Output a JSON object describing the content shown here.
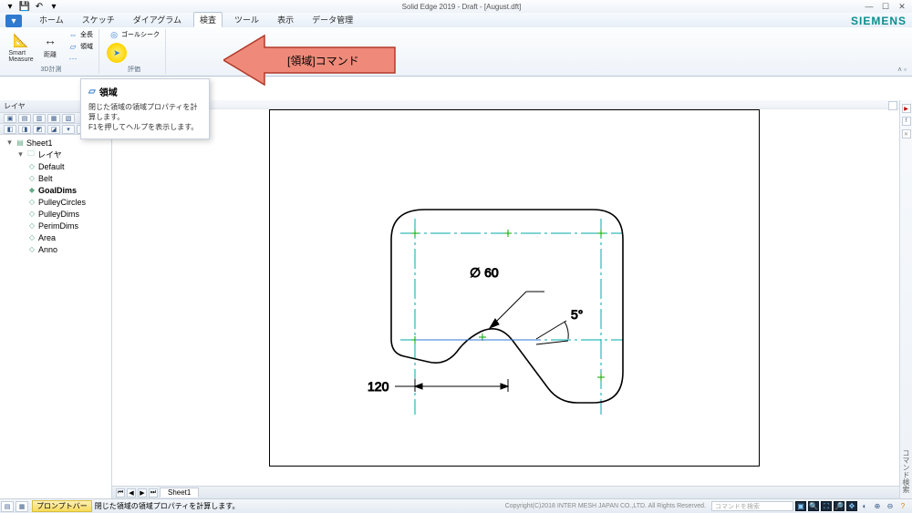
{
  "title": "Solid Edge 2019 - Draft - [August.dft]",
  "brand": "SIEMENS",
  "tabs": {
    "home": "ホーム",
    "sketch": "スケッチ",
    "diagram": "ダイアグラム",
    "inspect": "検査",
    "tool": "ツール",
    "view": "表示",
    "data": "データ管理"
  },
  "ribbon": {
    "smart_measure": "Smart\nMeasure",
    "distance": "距離",
    "total_length": "全長",
    "area": "領域",
    "goalseek": "ゴールシーク",
    "group_measure": "3D計測",
    "group_eval": "評価"
  },
  "tooltip": {
    "title": "領域",
    "line1": "閉じた領域の領域プロパティを計算します。",
    "line2": "F1を押してヘルプを表示します。"
  },
  "callout": "[領域]コマンド",
  "sidebar": {
    "pane": "レイヤ",
    "root": "Sheet1",
    "layers_group": "レイヤ",
    "layers": [
      "Default",
      "Belt",
      "GoalDims",
      "PulleyCircles",
      "PulleyDims",
      "PerimDims",
      "Area",
      "Anno"
    ],
    "bold_index": 2
  },
  "dimensions": {
    "diameter": "∅ 60",
    "angle": "5°",
    "width": "120"
  },
  "sheet_tab": "Sheet1",
  "status": {
    "prompt_label": "プロンプトバー",
    "prompt_text": "閉じた領域の領域プロパティを計算します。",
    "copyright": "Copyright(C)2018 INTER MESH JAPAN CO.,LTD. All Rights Reserved.",
    "cmd_placeholder": "コマンドを検索"
  }
}
